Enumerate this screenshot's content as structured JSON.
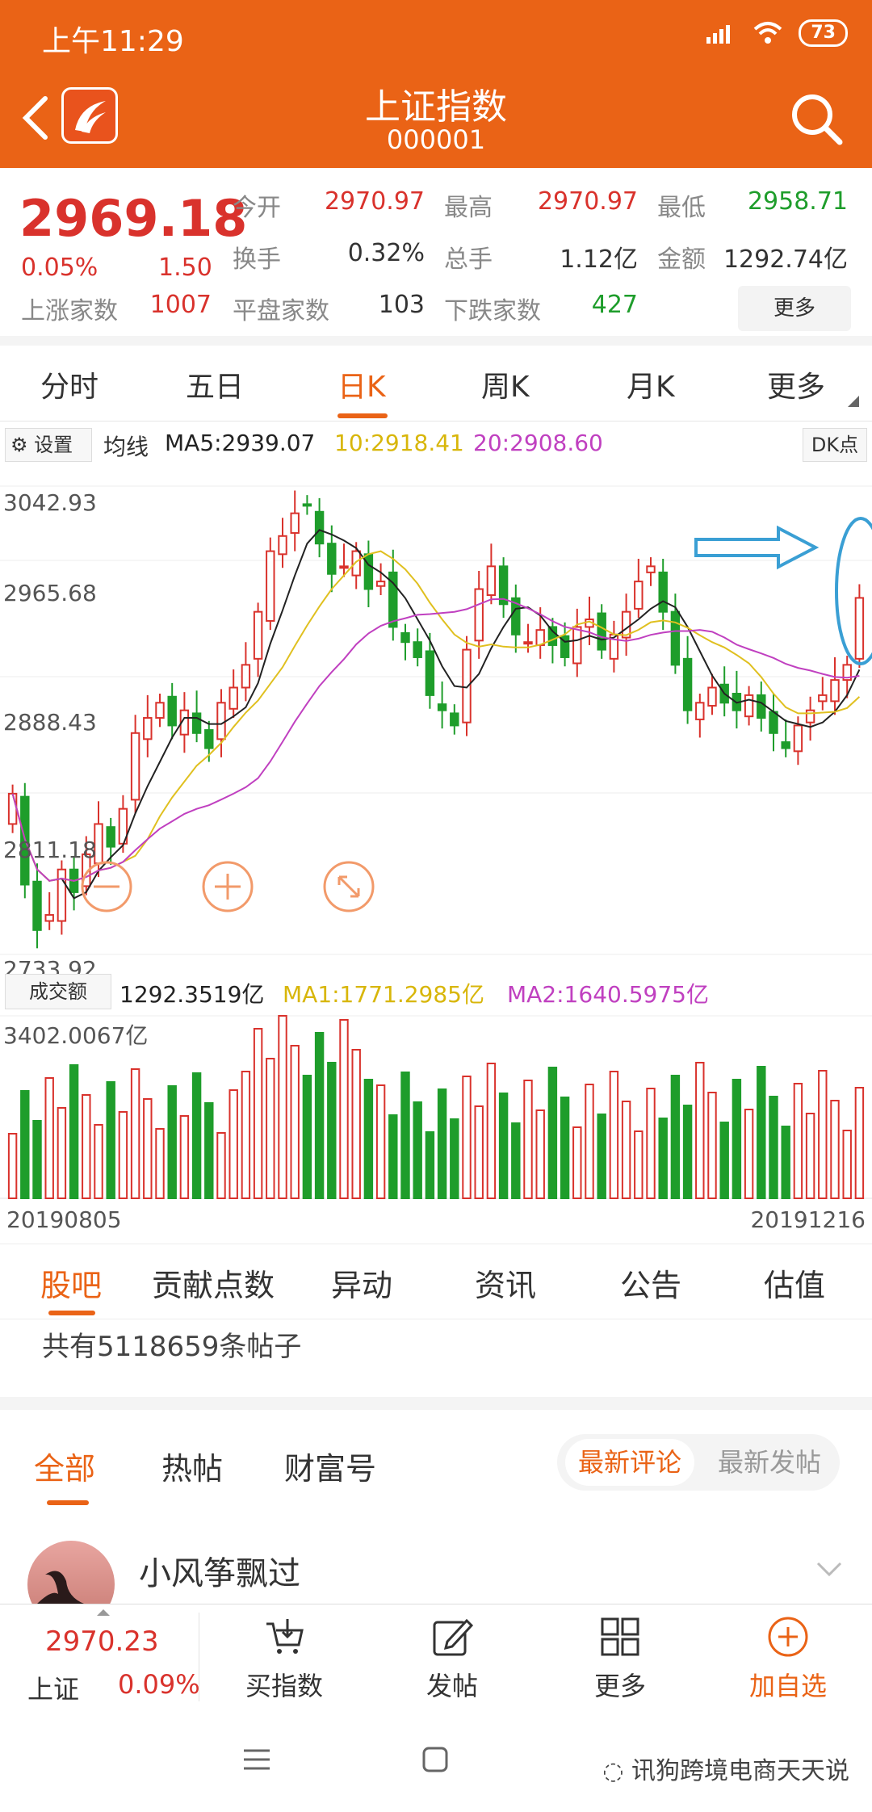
{
  "status_bar": {
    "time": "上午11:29",
    "battery": "73"
  },
  "header": {
    "title": "上证指数",
    "code": "000001"
  },
  "quote": {
    "price": "2969.18",
    "change_pct": "0.05%",
    "change_val": "1.50",
    "rows": [
      [
        {
          "label": "今开",
          "value": "2970.97",
          "color": "red"
        },
        {
          "label": "最高",
          "value": "2970.97",
          "color": "red"
        },
        {
          "label": "最低",
          "value": "2958.71",
          "color": "green"
        }
      ],
      [
        {
          "label": "换手",
          "value": "0.32%",
          "color": "dark"
        },
        {
          "label": "总手",
          "value": "1.12亿",
          "color": "dark"
        },
        {
          "label": "金额",
          "value": "1292.74亿",
          "color": "dark"
        }
      ],
      [
        {
          "label": "上涨家数",
          "value": "1007",
          "color": "red"
        },
        {
          "label": "平盘家数",
          "value": "103",
          "color": "dark"
        },
        {
          "label": "下跌家数",
          "value": "427",
          "color": "green"
        }
      ]
    ],
    "more": "更多"
  },
  "period_tabs": [
    "分时",
    "五日",
    "日K",
    "周K",
    "月K",
    "更多"
  ],
  "indicator": {
    "settings": "设置",
    "label": "均线",
    "ma5": "MA5:2939.07",
    "ma10": "10:2918.41",
    "ma20": "20:2908.60",
    "dk": "DK点"
  },
  "price_axis": [
    "3042.93",
    "2965.68",
    "2888.43",
    "2811.18",
    "2733.92"
  ],
  "volume": {
    "button": "成交额",
    "value": "1292.3519亿",
    "ma1": "MA1:1771.2985亿",
    "ma2": "MA2:1640.5975亿",
    "max": "3402.0067亿"
  },
  "dates": {
    "start": "20190805",
    "end": "20191216"
  },
  "chart_data": {
    "type": "candlestick",
    "y_range": [
      2733.92,
      3042.93
    ],
    "close": [
      2840,
      2780,
      2750,
      2760,
      2790,
      2775,
      2800,
      2820,
      2805,
      2830,
      2880,
      2890,
      2900,
      2885,
      2895,
      2880,
      2870,
      2900,
      2910,
      2925,
      2960,
      3000,
      3010,
      3025,
      3030,
      3005,
      2985,
      2990,
      3000,
      2975,
      2980,
      2950,
      2940,
      2930,
      2905,
      2895,
      2885,
      2935,
      2975,
      2990,
      2965,
      2945,
      2940,
      2948,
      2938,
      2930,
      2950,
      2955,
      2935,
      2945,
      2960,
      2980,
      2990,
      2960,
      2925,
      2895,
      2900,
      2910,
      2900,
      2895,
      2905,
      2890,
      2880,
      2870,
      2885,
      2895,
      2905,
      2915,
      2925,
      2969.18
    ],
    "ma_lines": [
      "MA5",
      "MA10",
      "MA20"
    ],
    "volume_max": "3402.0067亿"
  },
  "section_tabs": [
    "股吧",
    "贡献点数",
    "异动",
    "资讯",
    "公告",
    "估值"
  ],
  "post_count": "共有5118659条帖子",
  "forum_tabs": [
    "全部",
    "热帖",
    "财富号"
  ],
  "sort_options": [
    "最新评论",
    "最新发帖"
  ],
  "post": {
    "author": "小风筝飘过"
  },
  "bottom_bar": {
    "price": "2970.23",
    "label": "上证",
    "pct": "0.09%",
    "items": [
      "买指数",
      "发帖",
      "更多",
      "加自选"
    ]
  },
  "watermark": "讯狗跨境电商天天说",
  "colors": {
    "brand": "#ea6316",
    "up": "#d9322c",
    "down": "#1e9d2b"
  }
}
